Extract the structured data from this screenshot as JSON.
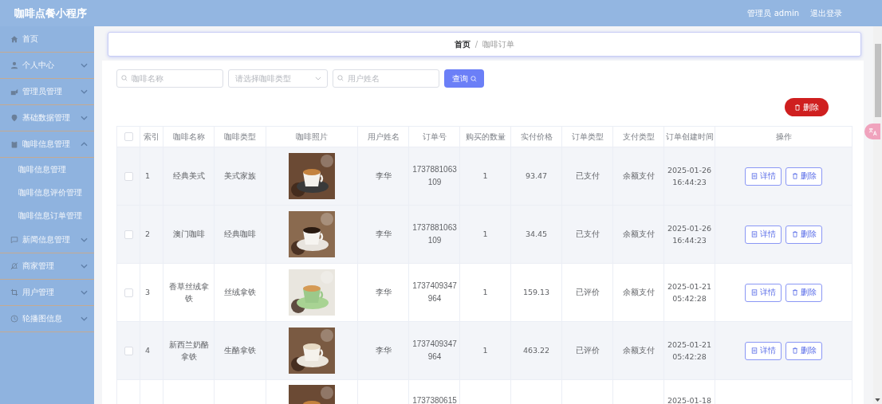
{
  "app_title": "咖啡点餐小程序",
  "header": {
    "user": "管理员 admin",
    "logout": "退出登录"
  },
  "sidebar": [
    {
      "label": "首页",
      "kind": "link"
    },
    {
      "label": "个人中心",
      "kind": "menu",
      "expanded": false
    },
    {
      "label": "管理员管理",
      "kind": "menu",
      "expanded": false
    },
    {
      "label": "基础数据管理",
      "kind": "menu",
      "expanded": false
    },
    {
      "label": "咖啡信息管理",
      "kind": "menu",
      "expanded": true,
      "children": [
        {
          "label": "咖啡信息管理"
        },
        {
          "label": "咖啡信息评价管理"
        },
        {
          "label": "咖啡信息订单管理"
        }
      ]
    },
    {
      "label": "新闻信息管理",
      "kind": "menu",
      "expanded": false
    },
    {
      "label": "商家管理",
      "kind": "menu",
      "expanded": false
    },
    {
      "label": "用户管理",
      "kind": "menu",
      "expanded": false
    },
    {
      "label": "轮播图信息",
      "kind": "menu",
      "expanded": false
    }
  ],
  "breadcrumb": {
    "items": [
      "首页",
      "咖啡订单"
    ],
    "separator": "/"
  },
  "search": {
    "name_placeholder": "咖啡名称",
    "type_placeholder": "请选择咖啡类型",
    "user_placeholder": "用户姓名",
    "button": "查询"
  },
  "bulk_delete": "删除",
  "table": {
    "header_checked": false,
    "columns": [
      "索引",
      "咖啡名称",
      "咖啡类型",
      "咖啡照片",
      "用户姓名",
      "订单号",
      "购买的数量",
      "实付价格",
      "订单类型",
      "支付类型",
      "订单创建时间",
      "操作"
    ],
    "rows": [
      {
        "checked": false,
        "highlighted": true,
        "index": "1",
        "name": "经典美式",
        "type": "美式家族",
        "user": "李华",
        "order_no": "1737881063109",
        "quantity": "1",
        "price": "93.47",
        "order_type": "已支付",
        "pay_type": "余额支付",
        "created": "2025-01-26 16:44:23",
        "actions": [
          "详情",
          "删除"
        ]
      },
      {
        "checked": false,
        "highlighted": true,
        "index": "2",
        "name": "澳门咖啡",
        "type": "经典咖啡",
        "user": "李华",
        "order_no": "1737881063109",
        "quantity": "1",
        "price": "34.45",
        "order_type": "已支付",
        "pay_type": "余额支付",
        "created": "2025-01-26 16:44:23",
        "actions": [
          "详情",
          "删除"
        ]
      },
      {
        "checked": false,
        "highlighted": false,
        "index": "3",
        "name": "香草丝绒拿铁",
        "type": "丝绒拿铁",
        "user": "李华",
        "order_no": "1737409347964",
        "quantity": "1",
        "price": "159.13",
        "order_type": "已评价",
        "pay_type": "余额支付",
        "created": "2025-01-21 05:42:28",
        "actions": [
          "详情",
          "删除"
        ]
      },
      {
        "checked": false,
        "highlighted": true,
        "index": "4",
        "name": "新西兰奶酪拿铁",
        "type": "生酪拿铁",
        "user": "李华",
        "order_no": "1737409347964",
        "quantity": "1",
        "price": "463.22",
        "order_type": "已评价",
        "pay_type": "余额支付",
        "created": "2025-01-21 05:42:28",
        "actions": [
          "详情",
          "删除"
        ]
      },
      {
        "highlighted": false,
        "order_no": "1737380615",
        "created": "2025-01-18"
      }
    ]
  }
}
